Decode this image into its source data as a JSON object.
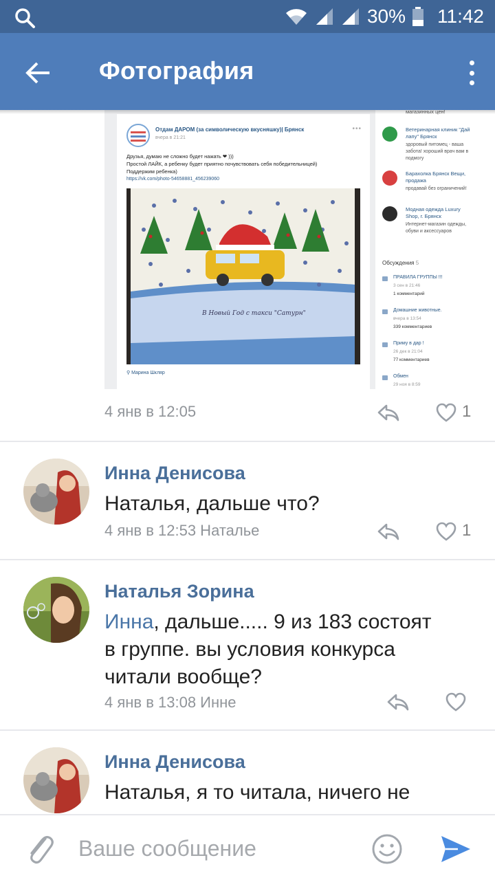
{
  "statusbar": {
    "battery": "30%",
    "time": "11:42"
  },
  "toolbar": {
    "title": "Фотография"
  },
  "photo_screenshot": {
    "group_name": "Отдам ДАРОМ (за символическую вкусняшку)| Брянск",
    "post_time": "вчера в 21:21",
    "post_text_1": "Друзья, думаю не сложно будет нажать ❤ )))",
    "post_text_2": "Простой ЛАЙК, а ребенку будет приятно почувствовать себя победительницей)",
    "post_text_3": "Поддержим ребенка)",
    "post_link": "https://vk.com/photo-54658881_456239060",
    "author": "Марина Шкляр",
    "sidebar": [
      {
        "name": "магазинных цен!",
        "desc": ""
      },
      {
        "name": "Ветеринарная клиник \"Дай лапу\" Брянск",
        "desc": "здоровый питомец - ваша забота! хороший врач вам в подмогу"
      },
      {
        "name": "Барахолка Брянск Вещи, продажа",
        "desc": "продавай без ограничений!"
      },
      {
        "name": "Модная одежда Luxury Shop, г. Брянск",
        "desc": "Интернет-магазин одежды, обуви и аксессуаров"
      }
    ],
    "discussions_label": "Обсуждения",
    "discussions_count": "5",
    "discussions": [
      {
        "title": "ПРАВИЛА ГРУППЫ !!!",
        "date": "3 сен в 21:46",
        "count": "1 комментарий"
      },
      {
        "title": "Домашние животные.",
        "date": "вчера в 13:54",
        "count": "339 комментариев"
      },
      {
        "title": "Приму в дар !",
        "date": "26 дек в 21:04",
        "count": "77 комментариев"
      },
      {
        "title": "Обмен",
        "date": "29 ноя в 8:59",
        "count": ""
      }
    ]
  },
  "photo_meta": {
    "date": "4 янв в 12:05",
    "likes": "1"
  },
  "comments": [
    {
      "author": "Инна Денисова",
      "text": "Наталья,  дальше что?",
      "meta": "4 янв в 12:53 Наталье",
      "likes": "1"
    },
    {
      "author": "Наталья Зорина",
      "mention": "Инна",
      "text_line1": ", дальше..... 9 из 183 состоят",
      "text_line2": "в группе. вы условия конкурса",
      "text_line3": "читали вообще?",
      "meta": "4 янв в 13:08 Инне",
      "likes": ""
    },
    {
      "author": "Инна Денисова",
      "text": "Наталья, я то читала, ничего не",
      "meta": "",
      "likes": ""
    }
  ],
  "input": {
    "placeholder": "Ваше сообщение"
  },
  "colors": {
    "statusbar": "#3f6596",
    "toolbar": "#4f7dba",
    "name": "#4a6f9a",
    "send": "#4a8be0"
  }
}
